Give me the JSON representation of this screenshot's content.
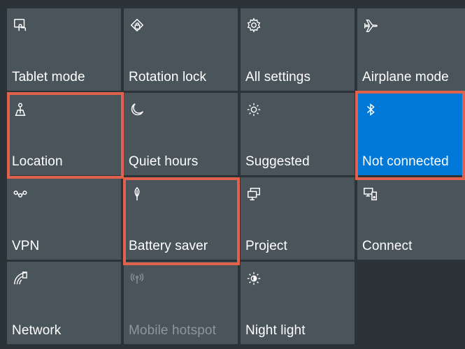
{
  "action_center": {
    "tiles": [
      {
        "label": "Tablet mode",
        "icon": "tablet-mode-icon"
      },
      {
        "label": "Rotation lock",
        "icon": "rotation-lock-icon"
      },
      {
        "label": "All settings",
        "icon": "gear-icon"
      },
      {
        "label": "Airplane mode",
        "icon": "airplane-icon"
      },
      {
        "label": "Location",
        "icon": "location-icon"
      },
      {
        "label": "Quiet hours",
        "icon": "moon-icon"
      },
      {
        "label": "Suggested",
        "icon": "brightness-icon"
      },
      {
        "label": "Not connected",
        "icon": "bluetooth-icon",
        "state": "active"
      },
      {
        "label": "VPN",
        "icon": "vpn-icon"
      },
      {
        "label": "Battery saver",
        "icon": "battery-saver-leaf-icon"
      },
      {
        "label": "Project",
        "icon": "project-icon"
      },
      {
        "label": "Connect",
        "icon": "connect-icon"
      },
      {
        "label": "Network",
        "icon": "network-icon"
      },
      {
        "label": "Mobile hotspot",
        "icon": "mobile-hotspot-icon",
        "state": "disabled"
      },
      {
        "label": "Night light",
        "icon": "night-light-icon"
      }
    ],
    "highlighted_tiles": [
      "Location",
      "Battery saver",
      "Not connected"
    ]
  },
  "colors": {
    "tile": "#4a545b",
    "active_tile": "#0078d7",
    "highlight": "#e2614d",
    "disabled_text": "#8d969b"
  }
}
